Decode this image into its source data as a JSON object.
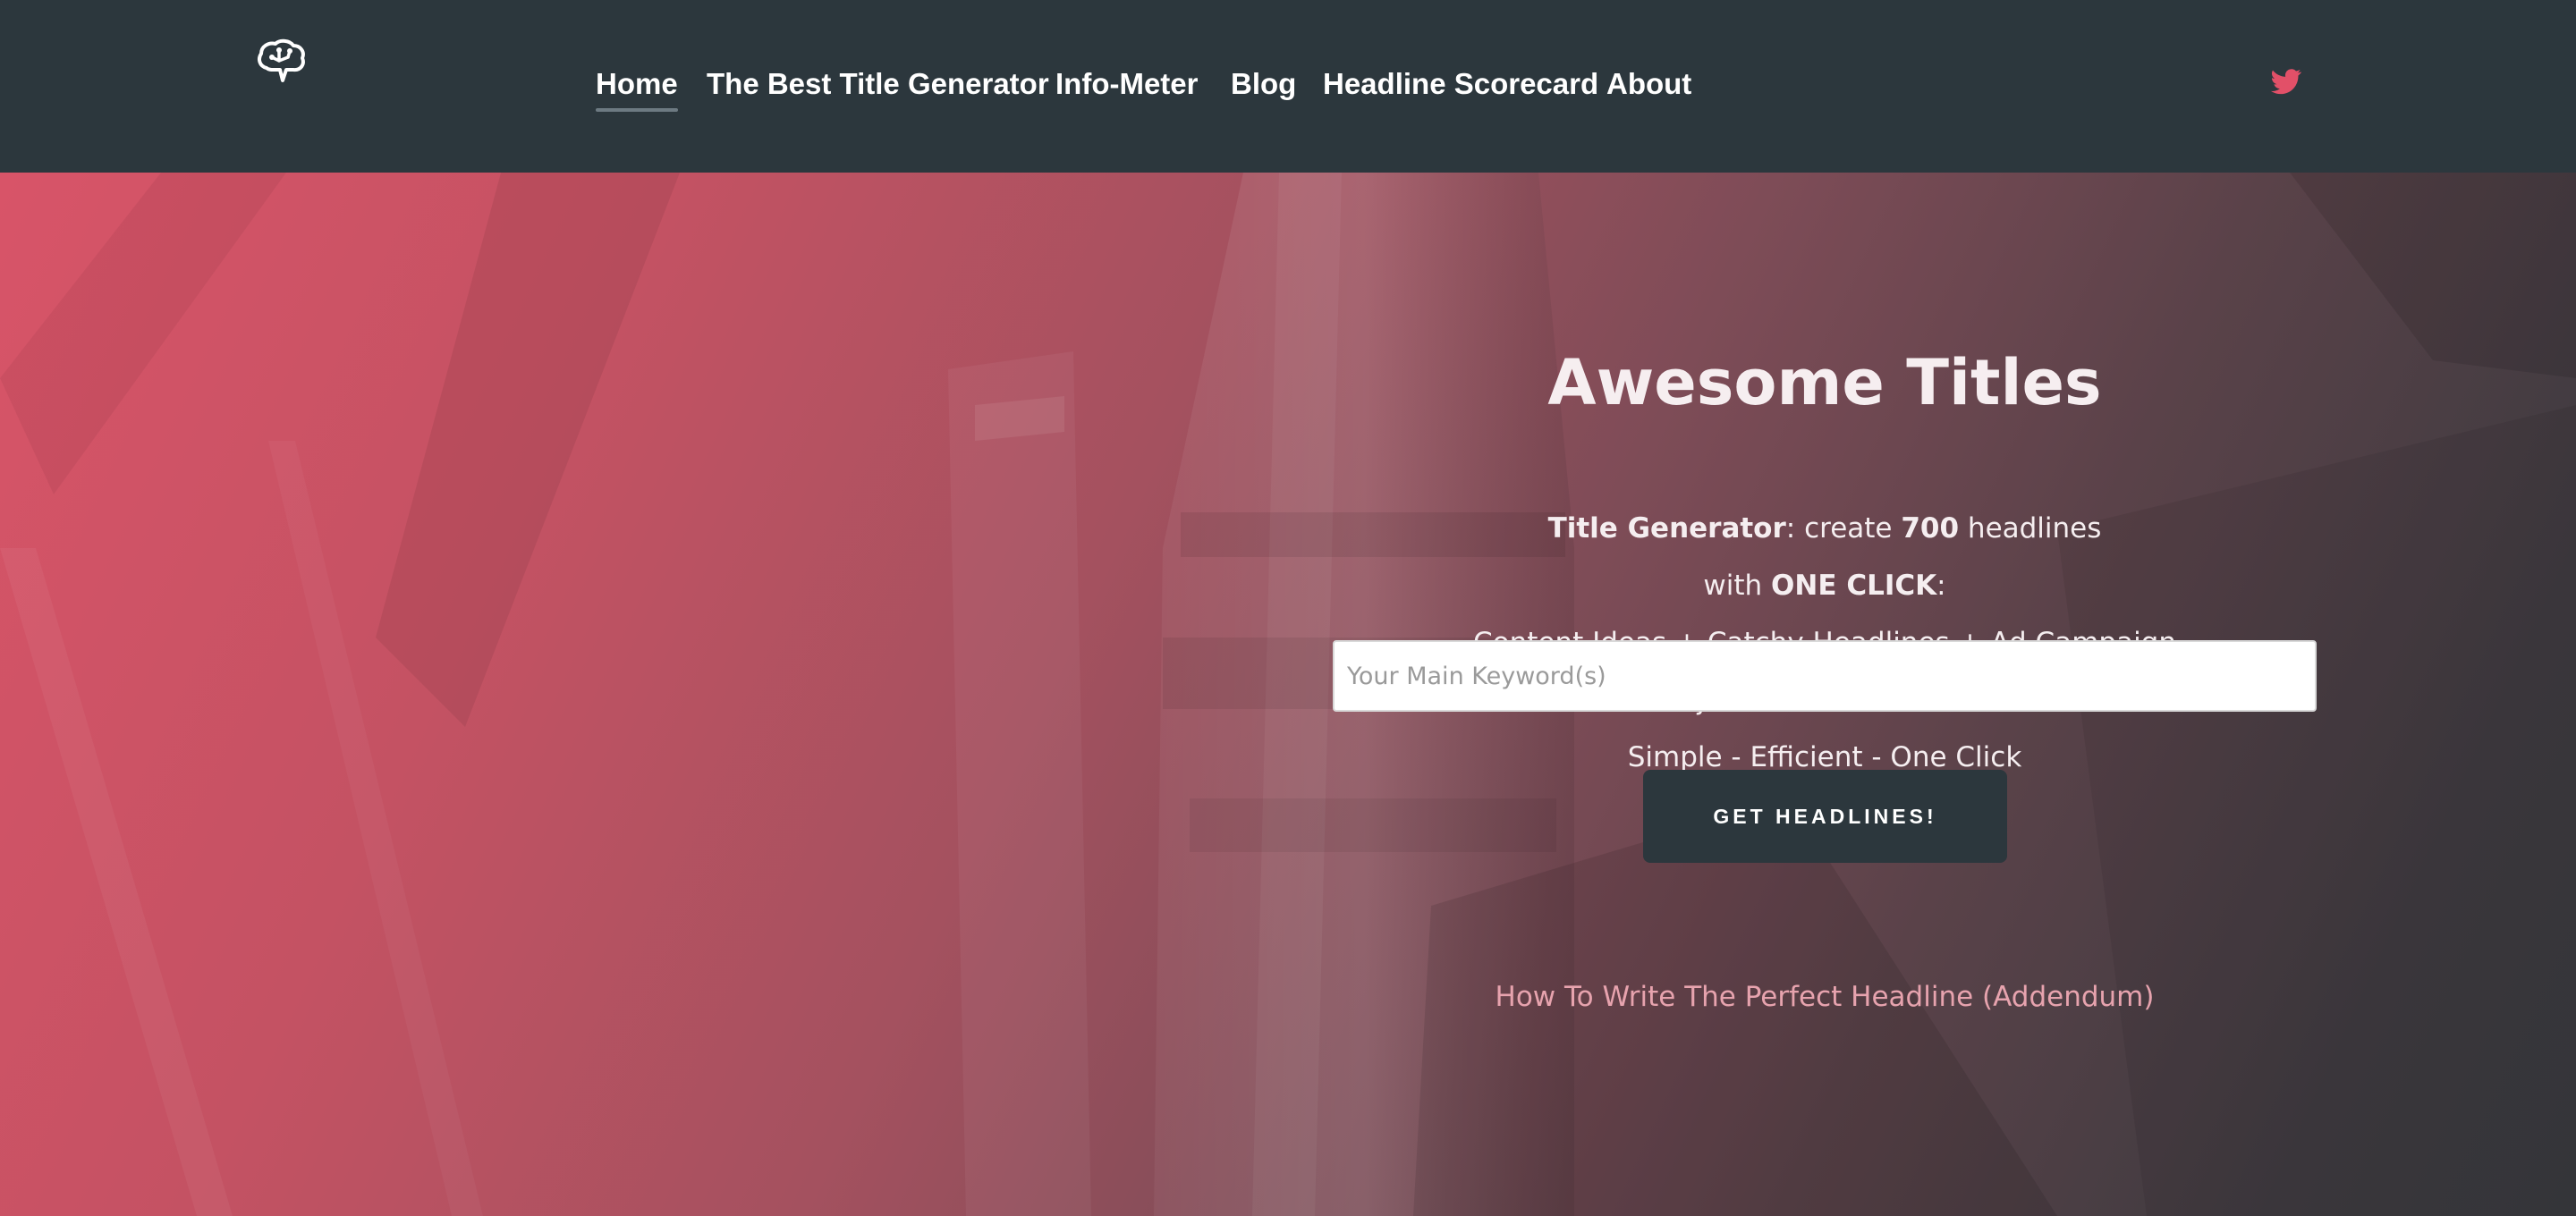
{
  "header": {
    "logo_icon": "brain-icon",
    "nav": [
      {
        "label": "Home",
        "active": true
      },
      {
        "label": "The Best Title Generator",
        "active": false
      },
      {
        "label": "Info-Meter",
        "active": false
      },
      {
        "label": "Blog",
        "active": false
      },
      {
        "label": "Headline Scorecard",
        "active": false
      },
      {
        "label": "About",
        "active": false
      }
    ],
    "social_icon": "twitter-icon"
  },
  "hero": {
    "title": "Awesome Titles",
    "line1": {
      "strong1": "Title Generator",
      "text1": ": create ",
      "strong2": "700",
      "text2": " headlines"
    },
    "line2": {
      "text1": "with ",
      "strong": "ONE CLICK",
      "text2": ":"
    },
    "line3": "Content Ideas + Catchy Headlines + Ad Campaign",
    "line4": "E-mail Subject Lines + Emotional Titles.",
    "line5": "Simple - Efficient - One Click",
    "keyword_placeholder": "Your Main Keyword(s)",
    "keyword_value": "",
    "button_label": "GET HEADLINES!",
    "addendum_link": "How To Write The Perfect Headline (Addendum)"
  },
  "colors": {
    "header_bg": "#2c373d",
    "accent": "#e25068",
    "hero_gradient_left": "#d85468",
    "hero_gradient_right": "#393a3e",
    "button_bg": "#2c373d",
    "link": "#e7a3ae"
  }
}
